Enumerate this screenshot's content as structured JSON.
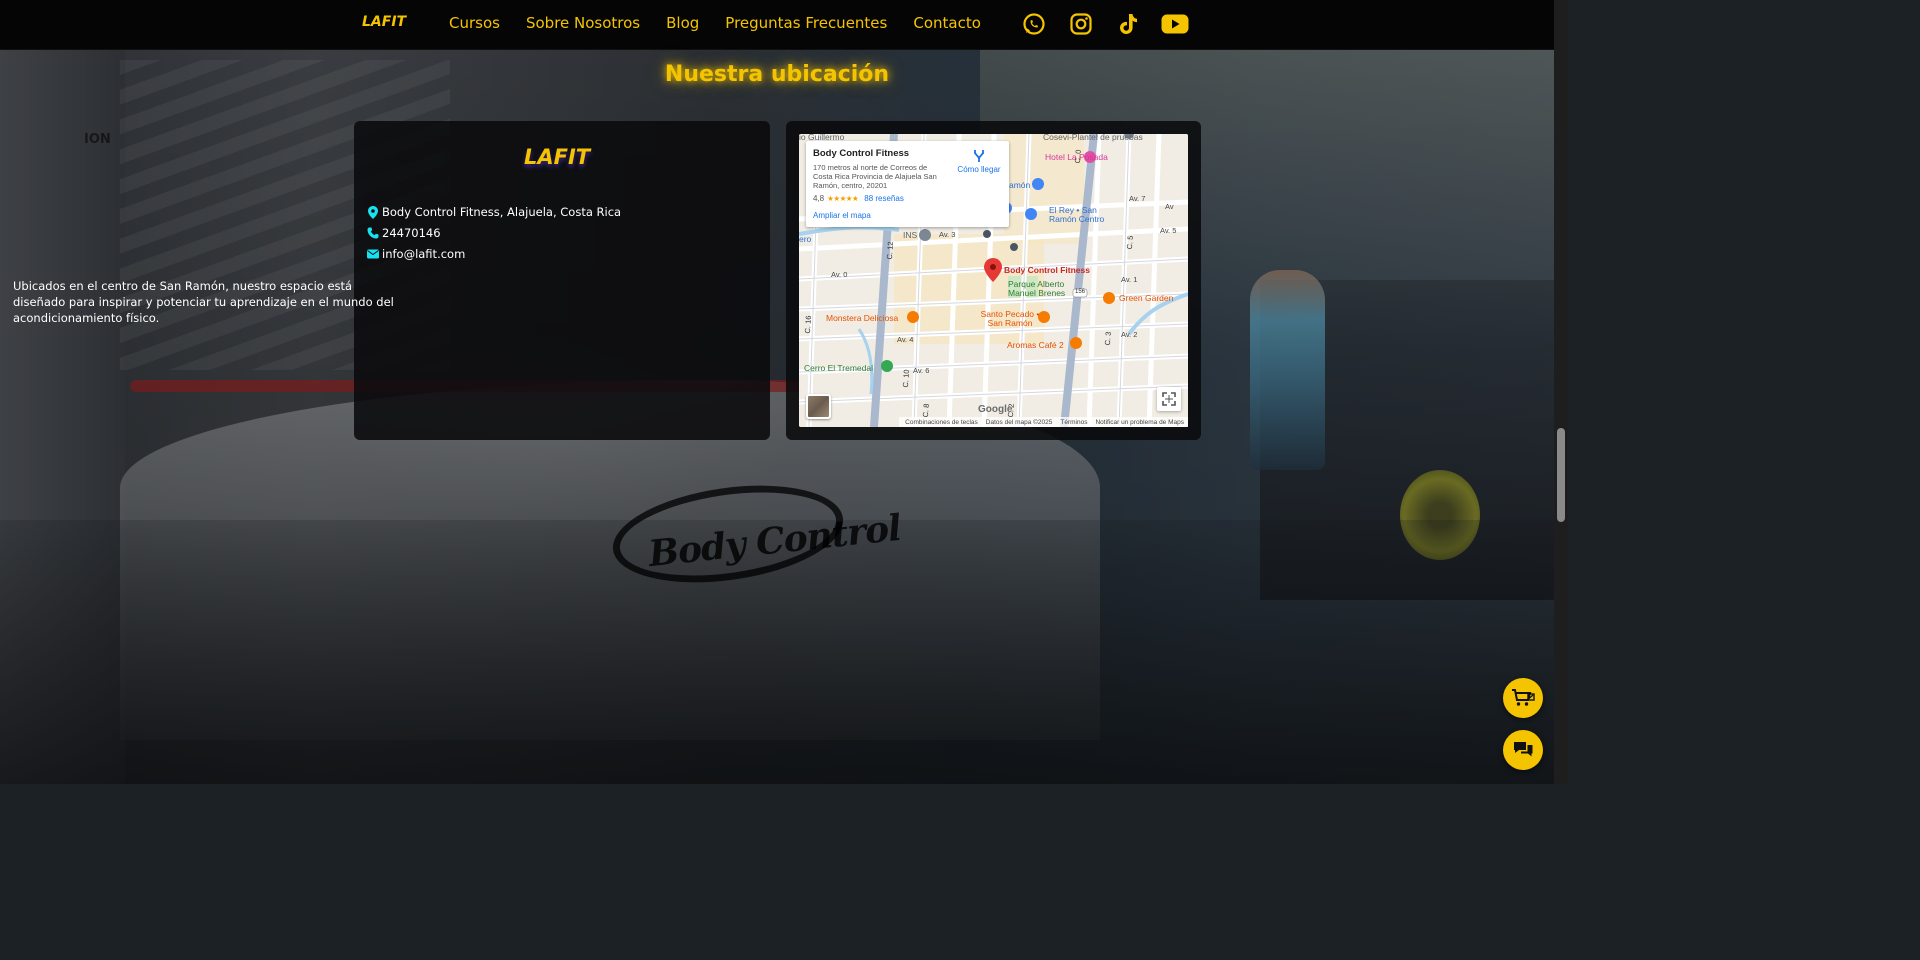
{
  "nav": {
    "brand": "LAFIT",
    "items": [
      "Cursos",
      "Sobre Nosotros",
      "Blog",
      "Preguntas Frecuentes",
      "Contacto"
    ],
    "socials": [
      "whatsapp-icon",
      "instagram-icon",
      "tiktok-icon",
      "youtube-icon"
    ]
  },
  "section": {
    "title": "Nuestra ubicación"
  },
  "info_card": {
    "logo": "LAFIT",
    "address": "Body Control Fitness, Alajuela, Costa Rica",
    "phone": "24470146",
    "email": "info@lafit.com",
    "description": "Ubicados en el centro de San Ramón, nuestro espacio está diseñado para inspirar y potenciar tu aprendizaje en el mundo del acondicionamiento físico."
  },
  "map": {
    "place_name": "Body Control Fitness",
    "place_address": "170 metros al norte de Correos de Costa Rica Provincia de Alajuela San Ramón, centro, 20201",
    "rating": "4,8",
    "stars": "★★★★★",
    "reviews": "88 reseñas",
    "enlarge": "Ampliar el mapa",
    "directions": "Cómo llegar",
    "google": "Google",
    "footer": [
      "Combinaciones de teclas",
      "Datos del mapa ©2025",
      "Términos",
      "Notificar un problema de Maps"
    ],
    "labels": {
      "hotel": "Hotel La Posada",
      "rey": "El Rey • San Ramón Centro",
      "marker": "Body Control Fitness",
      "parque": "Parque Alberto Manuel Brenes",
      "green": "Green Garden",
      "monstera": "Monstera Deliciosa",
      "santo": "Santo Pecado • San Ramón",
      "aromas": "Aromas Café 2",
      "cerro": "Cerro El Tremedal",
      "ins": "INS",
      "plantel": "Cosevi-Plantel de pruebas",
      "guillermo": "io Guillermo",
      "ramon": "amón",
      "ero": "ero",
      "av7": "Av. 7",
      "av5": "Av. 5",
      "av3": "Av. 3",
      "av1": "Av. 1",
      "av0": "Av. 0",
      "av2": "Av. 2",
      "av4": "Av. 4",
      "av6": "Av. 6",
      "c12": "C. 12",
      "c10": "C. 10",
      "c8": "C. 8",
      "c2": "C. 2",
      "c16": "C. 16",
      "c0": "C. 0",
      "c3": "C. 3",
      "c5": "C. 5",
      "av_edge": "Av",
      "badge156": "156"
    }
  },
  "colors": {
    "accent": "#f5c400",
    "cyan": "#17e3f0",
    "marker": "#e53935"
  }
}
